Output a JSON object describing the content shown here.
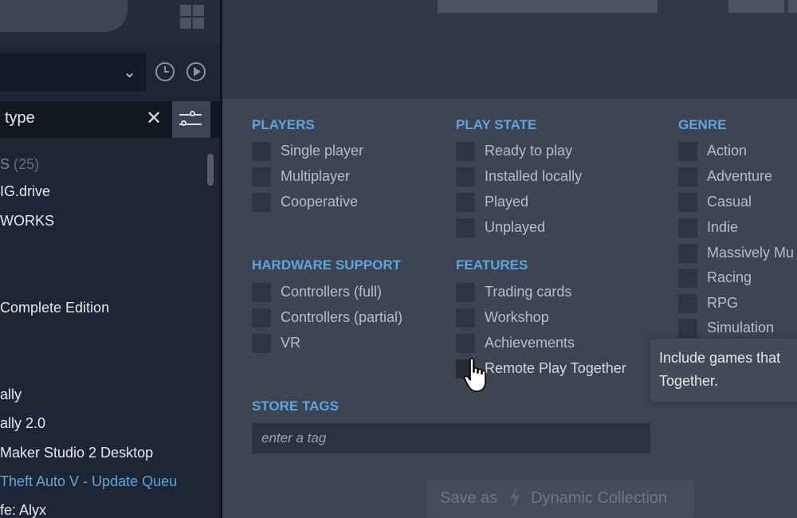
{
  "sidebar": {
    "search_text": "type",
    "game_list": [
      {
        "label": "S",
        "count": "(25)",
        "type": "header"
      },
      {
        "label": "IG.drive",
        "type": "game"
      },
      {
        "label": "WORKS",
        "type": "game"
      },
      {
        "label": "Complete Edition",
        "type": "game"
      },
      {
        "label": "ally",
        "type": "game"
      },
      {
        "label": "ally 2.0",
        "type": "game"
      },
      {
        "label": "Maker Studio 2 Desktop",
        "type": "game"
      },
      {
        "label": "Theft Auto V - Update Queu",
        "type": "updating",
        "color": "#5fa6da"
      },
      {
        "label": "fe: Alyx",
        "type": "game"
      }
    ]
  },
  "filter_panel": {
    "players": {
      "title": "PLAYERS",
      "options": [
        "Single player",
        "Multiplayer",
        "Cooperative"
      ]
    },
    "hardware_support": {
      "title": "HARDWARE SUPPORT",
      "options": [
        "Controllers (full)",
        "Controllers (partial)",
        "VR"
      ]
    },
    "play_state": {
      "title": "PLAY STATE",
      "options": [
        "Ready to play",
        "Installed locally",
        "Played",
        "Unplayed"
      ]
    },
    "features": {
      "title": "FEATURES",
      "options": [
        "Trading cards",
        "Workshop",
        "Achievements",
        "Remote Play Together"
      ]
    },
    "genre": {
      "title": "GENRE",
      "options": [
        "Action",
        "Adventure",
        "Casual",
        "Indie",
        "Massively Mu",
        "Racing",
        "RPG",
        "Simulation"
      ]
    },
    "store_tags": {
      "title": "STORE TAGS",
      "placeholder": "enter a tag"
    },
    "save_button": {
      "prefix": "Save as",
      "suffix": "Dynamic Collection"
    }
  },
  "tooltip": {
    "line1": "Include games that",
    "line2": "Together."
  },
  "colors": {
    "accent": "#5aa6e0",
    "panel_bg": "#3d4452",
    "checkbox_bg": "#2e3542",
    "updating_text": "#5fa6da"
  },
  "icons": [
    "grid-view-icon",
    "chevron-down-icon",
    "recent-clock-icon",
    "play-icon",
    "close-icon",
    "filter-sliders-icon",
    "lightning-bolt-icon",
    "hand-cursor-icon"
  ]
}
